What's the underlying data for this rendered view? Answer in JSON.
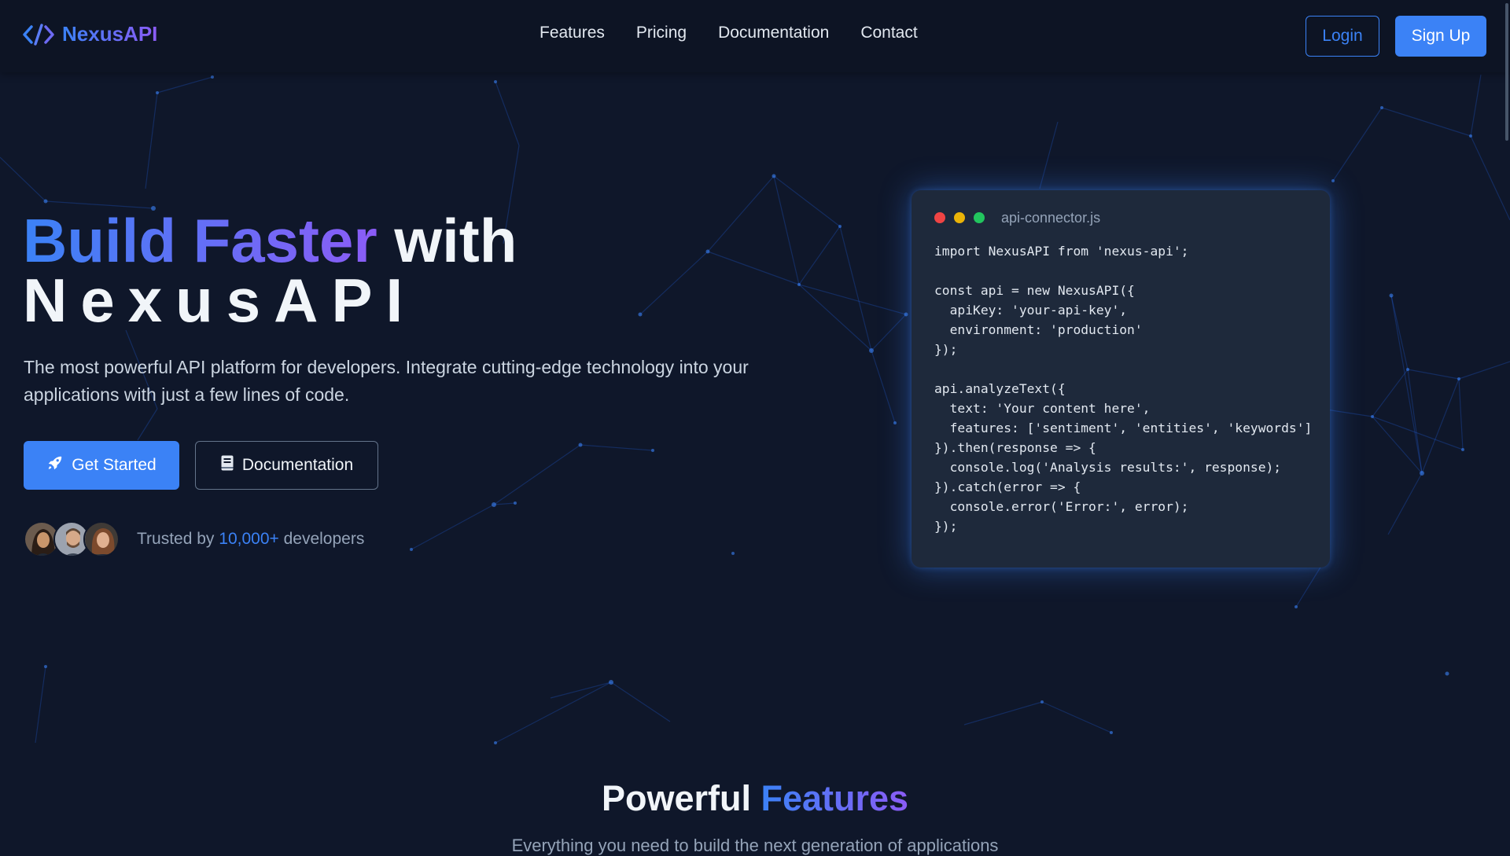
{
  "brand": {
    "name": "NexusAPI",
    "icon": "code-brackets-icon",
    "accent": "#3b82f6",
    "accent2": "#8b5cf6",
    "background": "#0f172a"
  },
  "nav": {
    "links": [
      "Features",
      "Pricing",
      "Documentation",
      "Contact"
    ],
    "login_label": "Login",
    "signup_label": "Sign Up"
  },
  "hero": {
    "title_highlight": "Build Faster",
    "title_rest": " with",
    "title_line2": "NexusAPI",
    "subtitle": "The most powerful API platform for developers. Integrate cutting-edge technology into your applications with just a few lines of code.",
    "primary_button": {
      "label": "Get Started",
      "icon": "rocket-icon"
    },
    "secondary_button": {
      "label": "Documentation",
      "icon": "book-icon"
    },
    "trusted": {
      "prefix": "Trusted by ",
      "count": "10,000+",
      "suffix": " developers"
    }
  },
  "code_window": {
    "filename": "api-connector.js",
    "code": "import NexusAPI from 'nexus-api';\n\nconst api = new NexusAPI({\n  apiKey: 'your-api-key',\n  environment: 'production'\n});\n\napi.analyzeText({\n  text: 'Your content here',\n  features: ['sentiment', 'entities', 'keywords']\n}).then(response => {\n  console.log('Analysis results:', response);\n}).catch(error => {\n  console.error('Error:', error);\n});"
  },
  "features": {
    "title_plain": "Powerful ",
    "title_highlight": "Features",
    "subtitle": "Everything you need to build the next generation of applications"
  }
}
